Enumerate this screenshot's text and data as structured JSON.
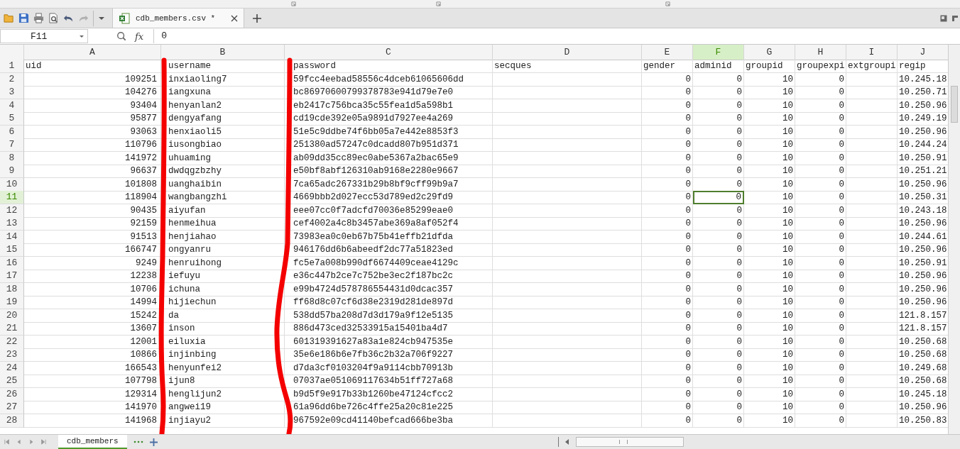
{
  "document_tab": {
    "label": "cdb_members.csv *",
    "selected": true
  },
  "name_box": "F11",
  "function_label": "fx",
  "formula": "0",
  "columns": [
    {
      "letter": "A",
      "header": "uid",
      "kind": "number",
      "selected": false
    },
    {
      "letter": "B",
      "header": "username",
      "kind": "text",
      "selected": false
    },
    {
      "letter": "C",
      "header": "password",
      "kind": "text",
      "selected": false
    },
    {
      "letter": "D",
      "header": "secques",
      "kind": "empty",
      "selected": false
    },
    {
      "letter": "E",
      "header": "gender",
      "kind": "number",
      "selected": false
    },
    {
      "letter": "F",
      "header": "adminid",
      "kind": "number",
      "selected": true
    },
    {
      "letter": "G",
      "header": "groupid",
      "kind": "number",
      "selected": false
    },
    {
      "letter": "H",
      "header": "groupexpi",
      "kind": "number",
      "selected": false
    },
    {
      "letter": "I",
      "header": "extgroupi",
      "kind": "empty",
      "selected": false
    },
    {
      "letter": "J",
      "header": "regip",
      "kind": "text",
      "selected": false
    }
  ],
  "header_row": {
    "number": "1",
    "selected": false
  },
  "rows": [
    {
      "number": "2",
      "selected": false,
      "values": [
        "109251",
        "inxiaoling7",
        "59fcc4eebad58556c4dceb61065606dd",
        "0",
        "0",
        "10",
        "0",
        "10.245.18"
      ]
    },
    {
      "number": "3",
      "selected": false,
      "values": [
        "104276",
        "iangxuna",
        "bc86970600799378783e941d79e7e0",
        "0",
        "0",
        "10",
        "0",
        "10.250.71"
      ]
    },
    {
      "number": "4",
      "selected": false,
      "values": [
        "93404",
        "henyanlan2",
        "eb2417c756bca35c55fea1d5a598b1",
        "0",
        "0",
        "10",
        "0",
        "10.250.96"
      ]
    },
    {
      "number": "5",
      "selected": false,
      "values": [
        "95877",
        "dengyafang",
        "cd19cde392e05a9891d7927ee4a269",
        "0",
        "0",
        "10",
        "0",
        "10.249.19"
      ]
    },
    {
      "number": "6",
      "selected": false,
      "values": [
        "93063",
        "henxiaoli5",
        "51e5c9ddbe74f6bb05a7e442e8853f3",
        "0",
        "0",
        "10",
        "0",
        "10.250.96"
      ]
    },
    {
      "number": "7",
      "selected": false,
      "values": [
        "110796",
        "iusongbiao",
        "251380ad57247c0dcadd807b951d371",
        "0",
        "0",
        "10",
        "0",
        "10.244.24"
      ]
    },
    {
      "number": "8",
      "selected": false,
      "values": [
        "141972",
        "uhuaming",
        "ab09dd35cc89ec0abe5367a2bac65e9",
        "0",
        "0",
        "10",
        "0",
        "10.250.91"
      ]
    },
    {
      "number": "9",
      "selected": false,
      "values": [
        "96637",
        "dwdqgzbzhy",
        "e50bf8abf126310ab9168e2280e9667",
        "0",
        "0",
        "10",
        "0",
        "10.251.21"
      ]
    },
    {
      "number": "10",
      "selected": false,
      "values": [
        "101808",
        "uanghaibin",
        "7ca65adc267331b29b8bf9cff99b9a7",
        "0",
        "0",
        "10",
        "0",
        "10.250.96"
      ]
    },
    {
      "number": "11",
      "selected": true,
      "values": [
        "118904",
        "wangbangzhi",
        "4669bbb2d027ecc53d789ed2c29fd9",
        "0",
        "0",
        "10",
        "0",
        "10.250.31"
      ]
    },
    {
      "number": "12",
      "selected": false,
      "values": [
        "90435",
        "aiyufan",
        "eee07cc0f7adcfd70036e85299eae0",
        "0",
        "0",
        "10",
        "0",
        "10.243.18"
      ]
    },
    {
      "number": "13",
      "selected": false,
      "values": [
        "92159",
        "henmeihua",
        "cef4002a4c8b3457abe369a8af052f4",
        "0",
        "0",
        "10",
        "0",
        "10.250.96"
      ]
    },
    {
      "number": "14",
      "selected": false,
      "values": [
        "91513",
        "henjiahao",
        "73983ea0c0eb67b75b41effb21dfda",
        "0",
        "0",
        "10",
        "0",
        "10.244.61"
      ]
    },
    {
      "number": "15",
      "selected": false,
      "values": [
        "166747",
        "ongyanru",
        "946176dd6b6abeedf2dc77a51823ed",
        "0",
        "0",
        "10",
        "0",
        "10.250.96"
      ]
    },
    {
      "number": "16",
      "selected": false,
      "values": [
        "9249",
        "henruihong",
        "fc5e7a008b990df6674409ceae4129c",
        "0",
        "0",
        "10",
        "0",
        "10.250.91"
      ]
    },
    {
      "number": "17",
      "selected": false,
      "values": [
        "12238",
        "iefuyu",
        "e36c447b2ce7c752be3ec2f187bc2c",
        "0",
        "0",
        "10",
        "0",
        "10.250.96"
      ]
    },
    {
      "number": "18",
      "selected": false,
      "values": [
        "10706",
        "ichuna",
        "e99b4724d578786554431d0dcac357",
        "0",
        "0",
        "10",
        "0",
        "10.250.96"
      ]
    },
    {
      "number": "19",
      "selected": false,
      "values": [
        "14994",
        "hijiechun",
        "ff68d8c07cf6d38e2319d281de897d",
        "0",
        "0",
        "10",
        "0",
        "10.250.96"
      ]
    },
    {
      "number": "20",
      "selected": false,
      "values": [
        "15242",
        "da",
        "538dd57ba208d7d3d179a9f12e5135",
        "0",
        "0",
        "10",
        "0",
        "121.8.157"
      ]
    },
    {
      "number": "21",
      "selected": false,
      "values": [
        "13607",
        "inson",
        "886d473ced32533915a15401ba4d7",
        "0",
        "0",
        "10",
        "0",
        "121.8.157"
      ]
    },
    {
      "number": "22",
      "selected": false,
      "values": [
        "12001",
        "eiluxia",
        "601319391627a83a1e824cb947535e",
        "0",
        "0",
        "10",
        "0",
        "10.250.68"
      ]
    },
    {
      "number": "23",
      "selected": false,
      "values": [
        "10866",
        "injinbing",
        "35e6e186b6e7fb36c2b32a706f9227",
        "0",
        "0",
        "10",
        "0",
        "10.250.68"
      ]
    },
    {
      "number": "24",
      "selected": false,
      "values": [
        "166543",
        "henyunfei2",
        "d7da3cf0103204f9a9114cbb70913b",
        "0",
        "0",
        "10",
        "0",
        "10.249.68"
      ]
    },
    {
      "number": "25",
      "selected": false,
      "values": [
        "107798",
        "ijun8",
        "07037ae051069117634b51ff727a68",
        "0",
        "0",
        "10",
        "0",
        "10.250.68"
      ]
    },
    {
      "number": "26",
      "selected": false,
      "values": [
        "129314",
        "henglijun2",
        "b9d5f9e917b33b1260be47124cfcc2",
        "0",
        "0",
        "10",
        "0",
        "10.245.18"
      ]
    },
    {
      "number": "27",
      "selected": false,
      "values": [
        "141970",
        "angwei19",
        "61a96dd6be726c4ffe25a20c81e225",
        "0",
        "0",
        "10",
        "0",
        "10.250.96"
      ]
    },
    {
      "number": "28",
      "selected": false,
      "values": [
        "141968",
        "injiayu2",
        "967592e09cd41140befcad666be3ba",
        "0",
        "0",
        "10",
        "0",
        "10.250.83"
      ]
    }
  ],
  "sheet_tabs": [
    {
      "label": "cdb_members",
      "selected": true
    }
  ]
}
